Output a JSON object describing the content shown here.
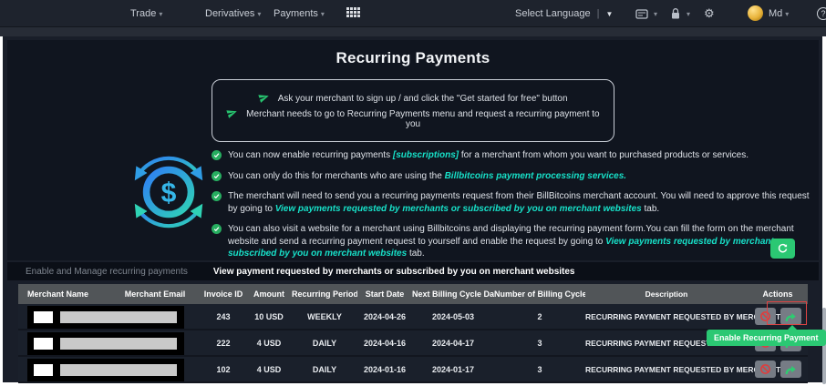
{
  "navbar": {
    "items": [
      {
        "label": "Trade"
      },
      {
        "label": "Derivatives"
      },
      {
        "label": "Payments"
      }
    ],
    "language_label": "Select Language",
    "user": {
      "name": "Md"
    }
  },
  "icons": {
    "caret": "▾",
    "triangle_down": "▼",
    "pipe": "|",
    "gear": "⚙",
    "help": "?",
    "dollar": "$"
  },
  "page": {
    "title": "Recurring Payments",
    "callout": [
      {
        "text": "Ask your merchant to sign up / and click the \"Get started for free\" button"
      },
      {
        "text": "Merchant needs to go to Recurring Payments menu and request a recurring payment to you"
      }
    ],
    "bullets": [
      {
        "pre": "You can now enable recurring payments ",
        "link": "[subscriptions]",
        "post": " for a merchant from whom you want to purchased products or services."
      },
      {
        "pre": "You can only do this for merchants who are using the ",
        "link": "Billbitcoins payment processing services.",
        "post": ""
      },
      {
        "pre": "The merchant will need to send you a recurring payments request from their BillBitcoins merchant account. You will need to approve this request by going to ",
        "link": "View payments requested by merchants or subscribed by you on merchant websites",
        "post": " tab."
      },
      {
        "pre": "You can also visit a website for a merchant using Billbitcoins and displaying the recurring payment form.You can fill the form on the merchant website and send a recurring payment request to yourself and enable the request by going to ",
        "link": "View payments requested by merchants or subscribed by you on merchant websites",
        "post": " tab."
      }
    ]
  },
  "tabs": [
    {
      "label": "Enable and Manage recurring payments",
      "active": false
    },
    {
      "label": "View payment requested by merchants or subscribed by you on merchant websites",
      "active": true
    }
  ],
  "table": {
    "columns": [
      "Merchant Name",
      "Merchant Email",
      "Invoice ID",
      "Amount",
      "Recurring Period",
      "Start Date",
      "Next Billing Cycle Date",
      "Number of Billing Cycles",
      "Description",
      "Actions"
    ],
    "rows": [
      {
        "invoice": "243",
        "amount": "10 USD",
        "period": "WEEKLY",
        "start_date": "2024-04-26",
        "next_billing": "2024-05-03",
        "cycles": "2",
        "description": "RECURRING PAYMENT REQUESTED BY MERCHANT"
      },
      {
        "invoice": "222",
        "amount": "4 USD",
        "period": "DAILY",
        "start_date": "2024-04-16",
        "next_billing": "2024-04-17",
        "cycles": "3",
        "description": "RECURRING PAYMENT REQUESTED BY MERCHANT"
      },
      {
        "invoice": "102",
        "amount": "4 USD",
        "period": "DAILY",
        "start_date": "2024-01-16",
        "next_billing": "2024-01-17",
        "cycles": "3",
        "description": "RECURRING PAYMENT REQUESTED BY MERCHANT"
      }
    ]
  },
  "tooltip": {
    "label": "Enable Recurring Payment"
  },
  "colors": {
    "accent_green": "#2bc873",
    "link_cyan": "#17e0c8",
    "danger_red": "#e04343",
    "gold": "#e8b33a",
    "navbar_bg": "#1e232d",
    "panel_bg": "#10151f"
  }
}
